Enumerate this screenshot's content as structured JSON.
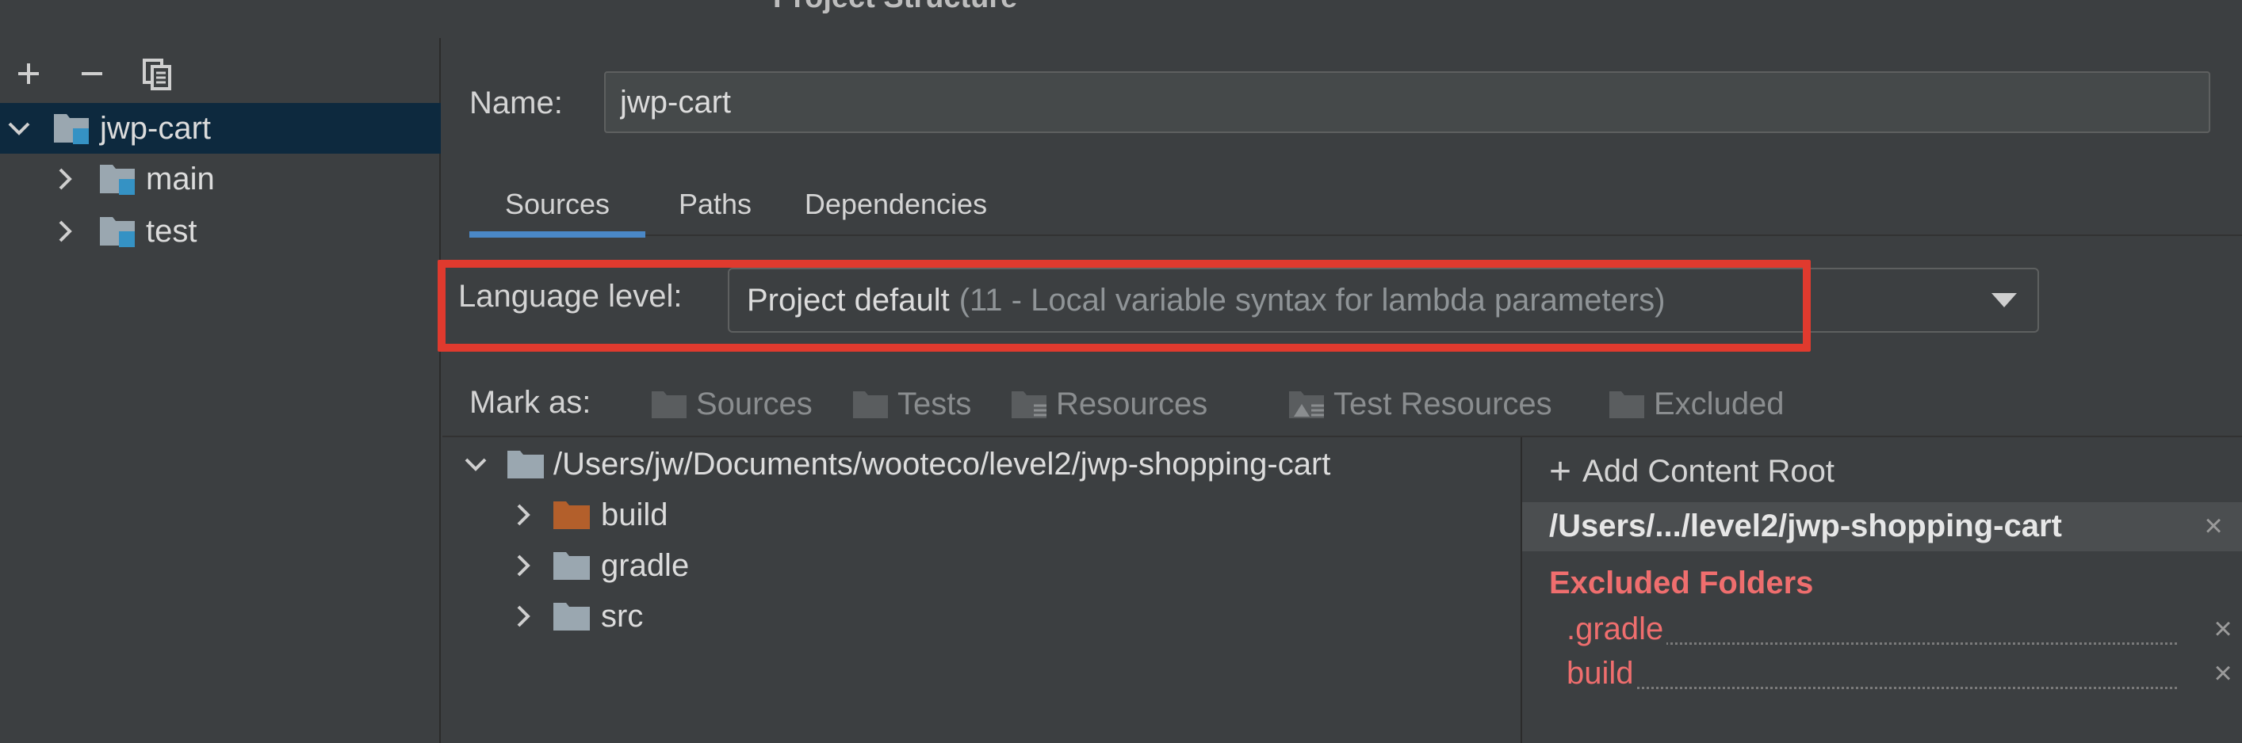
{
  "window": {
    "title": "Project Structure"
  },
  "sidebar": {
    "toolbar": {
      "add_icon": "plus-icon",
      "remove_icon": "minus-icon",
      "copy_icon": "copy-icon"
    },
    "tree": [
      {
        "label": "jwp-cart",
        "expanded": true,
        "selected": true,
        "icon": "module-folder-icon"
      },
      {
        "label": "main",
        "expanded": false,
        "icon": "module-folder-icon"
      },
      {
        "label": "test",
        "expanded": false,
        "icon": "module-folder-icon"
      }
    ]
  },
  "main": {
    "name_label": "Name:",
    "name_value": "jwp-cart",
    "tabs": [
      {
        "label": "Sources",
        "active": true
      },
      {
        "label": "Paths",
        "active": false
      },
      {
        "label": "Dependencies",
        "active": false
      }
    ],
    "language_level": {
      "label": "Language level:",
      "selected_primary": "Project default",
      "selected_secondary": "(11 - Local variable syntax for lambda parameters)"
    },
    "mark_as": {
      "label": "Mark as:",
      "buttons": [
        {
          "label": "Sources",
          "icon": "sources-folder-icon"
        },
        {
          "label": "Tests",
          "icon": "tests-folder-icon"
        },
        {
          "label": "Resources",
          "icon": "resources-folder-icon"
        },
        {
          "label": "Test Resources",
          "icon": "test-resources-folder-icon"
        },
        {
          "label": "Excluded",
          "icon": "excluded-folder-icon"
        }
      ]
    },
    "file_tree": [
      {
        "label": "/Users/jw/Documents/wooteco/level2/jwp-shopping-cart",
        "expanded": true
      },
      {
        "label": "build",
        "excluded": true
      },
      {
        "label": "gradle"
      },
      {
        "label": "src"
      }
    ],
    "content_root": {
      "add_label": "Add Content Root",
      "root_path": "/Users/.../level2/jwp-shopping-cart",
      "excluded_title": "Excluded Folders",
      "excluded": [
        ".gradle",
        "build"
      ]
    }
  },
  "colors": {
    "background": "#3c3f41",
    "selection": "#0d293e",
    "tab_indicator": "#4a88c7",
    "highlight_border": "#e03a2e",
    "excluded_text": "#ef6e6e",
    "excluded_folder": "#b35f2b"
  }
}
